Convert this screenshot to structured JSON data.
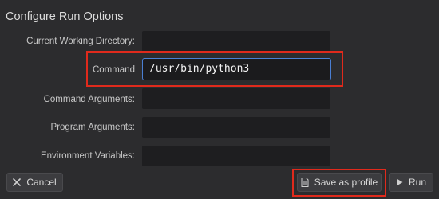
{
  "dialog": {
    "title": "Configure Run Options"
  },
  "fields": {
    "cwd_label": "Current Working Directory:",
    "cwd_value": "",
    "command_label": "Command",
    "command_value": "/usr/bin/python3",
    "cmd_args_label": "Command Arguments:",
    "cmd_args_value": "",
    "prog_args_label": "Program Arguments:",
    "prog_args_value": "",
    "env_label": "Environment Variables:",
    "env_value": ""
  },
  "buttons": {
    "cancel_label": "Cancel",
    "save_profile_label": "Save as profile",
    "run_label": "Run"
  },
  "colors": {
    "highlight": "#e02a1c",
    "focus_border": "#4a7fd4"
  },
  "icons": {
    "cancel": "x-icon",
    "save_profile": "document-icon",
    "run": "play-icon"
  }
}
